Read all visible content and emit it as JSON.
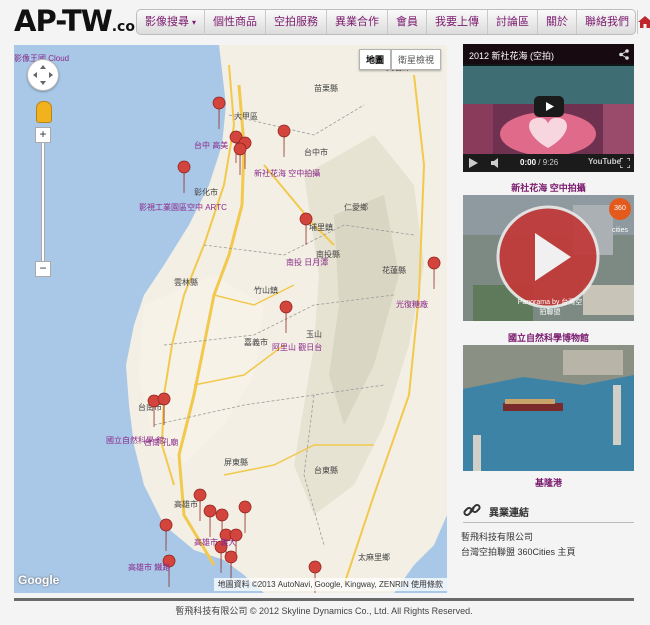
{
  "header": {
    "logo_main": "AP-TW",
    "logo_suffix": ".com",
    "nav": [
      {
        "label": "影像搜尋",
        "has_caret": true
      },
      {
        "label": "個性商品"
      },
      {
        "label": "空拍服務"
      },
      {
        "label": "異業合作"
      },
      {
        "label": "會員"
      },
      {
        "label": "我要上傳"
      },
      {
        "label": "討論區"
      },
      {
        "label": "關於"
      },
      {
        "label": "聯絡我們"
      }
    ],
    "home_icon": "home-icon"
  },
  "map": {
    "type_buttons": [
      "地圖",
      "衛星檢視"
    ],
    "top_left_label": "影像王國 Cloud",
    "google": "Google",
    "attribution": "地圖資料 ©2013 AutoNavi, Google, Kingway, ZENRIN",
    "terms": "使用條款",
    "place_labels": [
      "尖石鄉",
      "苗栗縣",
      "大甲區",
      "台中市",
      "仁愛鄉",
      "彰化市",
      "南投縣",
      "花蓮縣",
      "雲林縣",
      "竹山鎮",
      "嘉義市",
      "台南市",
      "高雄市",
      "台東縣",
      "屏東縣",
      "玉山",
      "埔里鎮",
      "太麻里鄉"
    ],
    "marker_labels": [
      "台中 高美",
      "新社花海 空中拍攝",
      "影視工業園區空中 ARTC",
      "南投 日月潭",
      "光復糖廠",
      "阿里山 觀日台",
      "國立自然科學 館",
      "高雄市 義大",
      "高雄市 鐵路",
      "台南 孔廟"
    ]
  },
  "sidebar": {
    "video": {
      "title": "2012 新社花海 (空拍)",
      "time_current": "0:00",
      "time_total": "9:26",
      "caption": "新社花海 空中拍攝",
      "youtube": "YouTube"
    },
    "panorama": {
      "badge": "360 cities",
      "overlay": "Panorama by 台灣空拍聯盟",
      "caption": "國立自然科學博物館"
    },
    "photo": {
      "caption": "基隆港"
    },
    "links_title": "異業連結",
    "links": [
      "暫飛科技有限公司",
      "台灣空拍聯盟 360Cities 主頁"
    ]
  },
  "footer": {
    "text": "暫飛科技有限公司 © 2012 Skyline Dynamics Co., Ltd. All Rights Reserved."
  }
}
